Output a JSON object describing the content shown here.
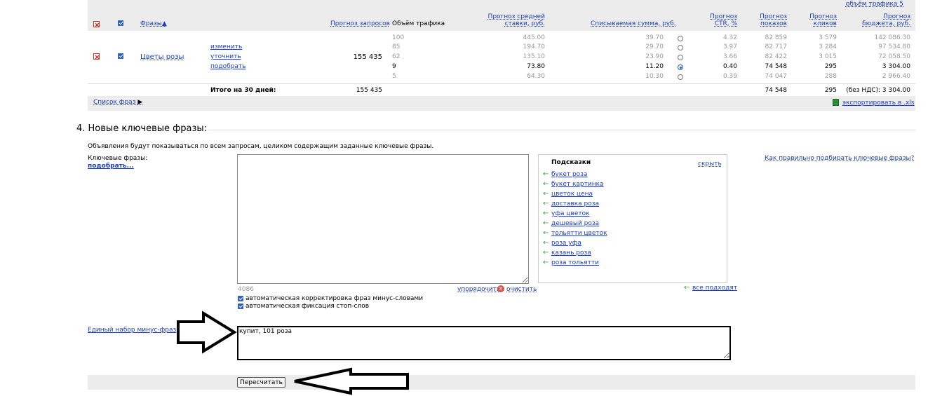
{
  "table": {
    "headers": {
      "phrases": "Фразы▲",
      "requests": "Прогноз запросов",
      "traffic": "Объём трафика",
      "avg_bid_1": "Прогноз средней",
      "avg_bid_2": "ставки, руб.",
      "charge": "Списываемая сумма, руб.",
      "ctr_1": "Прогноз",
      "ctr_2": "CTR, %",
      "shows_1": "Прогноз",
      "shows_2": "показов",
      "clicks_1": "Прогноз",
      "clicks_2": "кликов",
      "budget_1": "Прогноз",
      "budget_2": "бюджета, руб.",
      "top_partial": "объём трафика 5"
    },
    "phrase": {
      "name": "Цветы розы",
      "actions": [
        "изменить",
        "уточнить",
        "подобрать"
      ],
      "requests": "155 435"
    },
    "rows": [
      {
        "traffic": "100",
        "bid": "445.00",
        "charge": "39.70",
        "ctr": "4.32",
        "shows": "82 859",
        "clicks": "3 579",
        "budget": "142 086.30",
        "selected": false
      },
      {
        "traffic": "85",
        "bid": "194.70",
        "charge": "29.70",
        "ctr": "3.97",
        "shows": "82 717",
        "clicks": "3 284",
        "budget": "97 534.80",
        "selected": false
      },
      {
        "traffic": "62",
        "bid": "135.10",
        "charge": "23.90",
        "ctr": "3.66",
        "shows": "82 422",
        "clicks": "3 015",
        "budget": "72 058.50",
        "selected": false
      },
      {
        "traffic": "9",
        "bid": "73.80",
        "charge": "11.20",
        "ctr": "0.40",
        "shows": "74 548",
        "clicks": "295",
        "budget": "3 304.00",
        "selected": true
      },
      {
        "traffic": "5",
        "bid": "64.30",
        "charge": "10.30",
        "ctr": "0.39",
        "shows": "74 047",
        "clicks": "288",
        "budget": "2 966.40",
        "selected": false
      }
    ],
    "total": {
      "label": "Итого на 30 дней:",
      "requests": "155 435",
      "shows": "74 548",
      "clicks": "295",
      "budget": "(без НДС): 3 304.00"
    },
    "phrase_list_link": "Список фраз",
    "export_link": "экспортировать в .xls"
  },
  "section": {
    "title": "4. Новые ключевые фразы:",
    "note": "Объявления будут показываться по всем запросам, целиком содержащим заданные ключевые фразы.",
    "keywords_label": "Ключевые фразы:",
    "pick_link": "подобрать...",
    "keywords_value": "",
    "char_count": "4086",
    "sort_link": "упорядочить",
    "clear_link": "очистить",
    "auto_correct": "автоматическая корректировка фраз минус-словами",
    "auto_fix": "автоматическая фиксация стоп-слов",
    "help_link": "Как правильно подбирать ключевые фразы?",
    "minus_label": "Единый набор минус-фраз",
    "minus_value": "купит, 101 роза",
    "recalc_button": "Пересчитать"
  },
  "hints": {
    "title": "Подсказки",
    "hide": "скрыть",
    "items": [
      "букет роза",
      "букет картинка",
      "цветок цена",
      "доставка роза",
      "уфа цветок",
      "дешевый роза",
      "тольятти цветок",
      "роза уфа",
      "казань роза",
      "роза тольятти"
    ],
    "all_fit": "все подходят"
  },
  "colors": {
    "link": "#1a3dc1",
    "header_bg": "#ececec",
    "hint_arrow": "#3aa335",
    "delete_red": "#c0392b"
  }
}
